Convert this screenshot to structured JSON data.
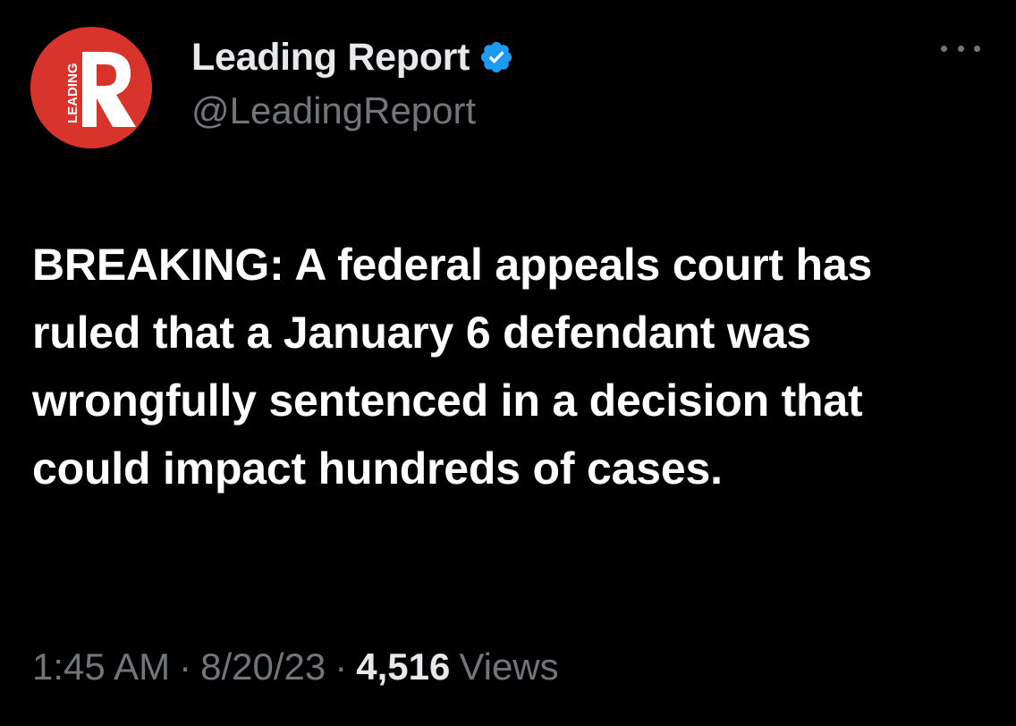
{
  "account": {
    "display_name": "Leading Report",
    "handle": "@LeadingReport",
    "avatar": {
      "letter": "R",
      "vertical_text": "LEADING",
      "background_color": "#d8342c"
    },
    "verified_color": "#1d9bf0",
    "icons": {
      "verified": "verified-badge-icon",
      "more": "more-options-icon"
    }
  },
  "tweet": {
    "text": "BREAKING: A federal appeals court has ruled that a January 6 defendant was wrongfully sentenced in a decision that could impact hundreds of cases."
  },
  "meta": {
    "time": "1:45 AM",
    "separator": "·",
    "date": "8/20/23",
    "views_count": "4,516",
    "views_label": "Views"
  },
  "colors": {
    "background": "#000000",
    "text": "#ffffff",
    "secondary_text": "#71767b"
  }
}
